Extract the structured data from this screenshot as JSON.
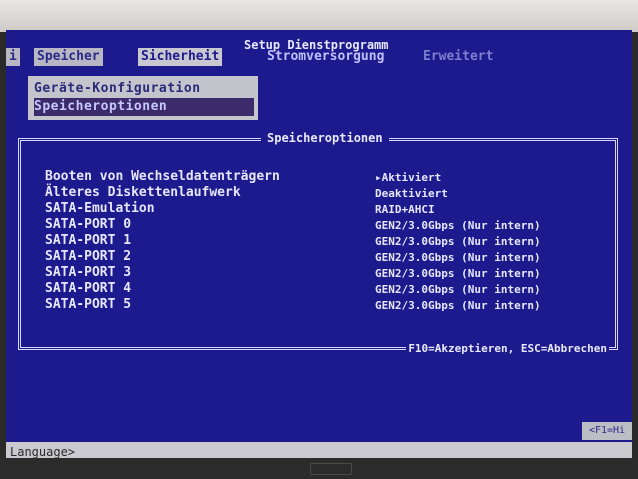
{
  "title": "Setup Dienstprogramm",
  "menus": [
    "i",
    "Speicher",
    "Sicherheit",
    "Stromversorgung",
    "Erweitert"
  ],
  "submenu": [
    "Geräte-Konfiguration",
    "Speicheroptionen"
  ],
  "dialog": {
    "title": "Speicheroptionen",
    "rows": [
      {
        "label": "Booten von Wechseldatenträgern",
        "value": "▸Aktiviert"
      },
      {
        "label": "Älteres Diskettenlaufwerk",
        "value": "Deaktiviert"
      },
      {
        "label": "SATA-Emulation",
        "value": "RAID+AHCI"
      },
      {
        "label": "SATA-PORT 0",
        "value": "GEN2/3.0Gbps (Nur intern)"
      },
      {
        "label": "SATA-PORT 1",
        "value": "GEN2/3.0Gbps (Nur intern)"
      },
      {
        "label": "SATA-PORT 2",
        "value": "GEN2/3.0Gbps (Nur intern)"
      },
      {
        "label": "SATA-PORT 3",
        "value": "GEN2/3.0Gbps (Nur intern)"
      },
      {
        "label": "SATA-PORT 4",
        "value": "GEN2/3.0Gbps (Nur intern)"
      },
      {
        "label": "SATA-PORT 5",
        "value": "GEN2/3.0Gbps (Nur intern)"
      }
    ],
    "footer": "F10=Akzeptieren, ESC=Abbrechen"
  },
  "status": {
    "left": "Language>",
    "right": "<F1=Hi"
  }
}
